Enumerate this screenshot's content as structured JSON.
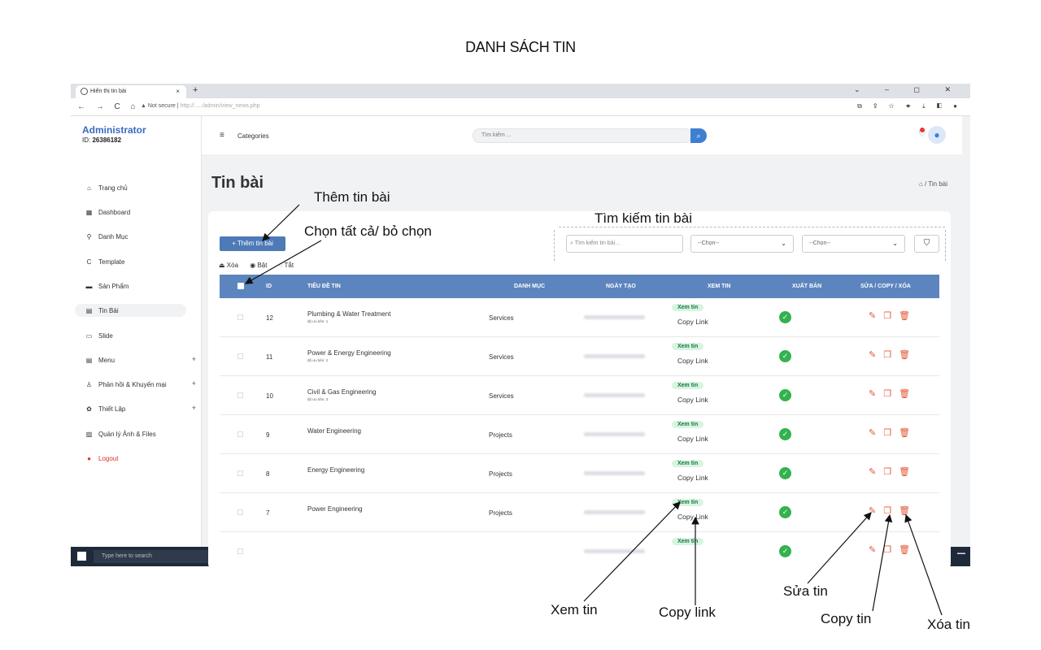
{
  "doc_title": "DANH SÁCH TIN",
  "browser": {
    "tab_title": "Hiển thị tin bài",
    "tab_close": "×",
    "new_tab": "+",
    "window_controls": "⌄ – ◻ ✕",
    "nav": "← → C ⌂",
    "security": "▲ Not secure",
    "url": "http://...../admin/view_news.php",
    "addr_icons": "⧉ ⇪ ☆ ✦ ⤓ ◧ ●"
  },
  "sidebar": {
    "admin_name": "Administrator",
    "admin_id_label": "ID:",
    "admin_id": "26386182",
    "items": [
      {
        "icon": "⌂",
        "label": "Trang chủ"
      },
      {
        "icon": "▦",
        "label": "Dashboard"
      },
      {
        "icon": "⚲",
        "label": "Danh Mục"
      },
      {
        "icon": "C",
        "label": "Template"
      },
      {
        "icon": "▬",
        "label": "Sản Phẩm"
      },
      {
        "icon": "▤",
        "label": "Tin Bài"
      },
      {
        "icon": "▭",
        "label": "Slide"
      },
      {
        "icon": "▤",
        "label": "Menu",
        "plus": "+"
      },
      {
        "icon": "♙",
        "label": "Phản hồi & Khuyến mại",
        "plus": "+"
      },
      {
        "icon": "✿",
        "label": "Thiết Lập",
        "plus": "+"
      },
      {
        "icon": "▨",
        "label": "Quản lý Ảnh & Files"
      },
      {
        "icon": "●",
        "label": "Logout"
      }
    ]
  },
  "topbar": {
    "menu_icon": "≡",
    "categories": "Categories",
    "search_placeholder": "Tìm kiếm ...",
    "search_icon": "⌕"
  },
  "content": {
    "page_title": "Tin bài",
    "breadcrumb": "⌂ / Tin bài",
    "add_button": "+ Thêm tin bài",
    "bulk_delete": "⏏ Xóa",
    "bulk_on": "◉ Bật",
    "bulk_off": "◌ Tắt",
    "filter_search_placeholder": "⌕ Tìm kiếm tin bài...",
    "select1": "--Chọn--",
    "select2": "--Chọn--",
    "filter_icon": "⛉"
  },
  "table": {
    "headers": {
      "id": "ID",
      "title": "TIÊU ĐỀ TIN",
      "category": "DANH MỤC",
      "date": "NGÀY TẠO",
      "view": "XEM TIN",
      "publish": "XUẤT BẢN",
      "actions": "SỬA / COPY / XÓA"
    },
    "view_label": "Xem tin",
    "copy_label": "Copy Link",
    "rows": [
      {
        "id": "12",
        "title": "Plumbing & Water Treatment",
        "sub": "độ ưu tiên: 1",
        "category": "Services"
      },
      {
        "id": "11",
        "title": "Power & Energy Engineering",
        "sub": "độ ưu tiên: 2",
        "category": "Services"
      },
      {
        "id": "10",
        "title": "Civil & Gas Engineering",
        "sub": "độ ưu tiên: 3",
        "category": "Services"
      },
      {
        "id": "9",
        "title": "Water Engineering",
        "sub": "",
        "category": "Projects"
      },
      {
        "id": "8",
        "title": "Energy Engineering",
        "sub": "",
        "category": "Projects"
      },
      {
        "id": "7",
        "title": "Power Engineering",
        "sub": "",
        "category": "Projects"
      },
      {
        "id": "",
        "title": "",
        "sub": "",
        "category": ""
      }
    ]
  },
  "taskbar": {
    "search": "Type here to search"
  },
  "annotations": {
    "add": "Thêm tin bài",
    "select_all": "Chọn tất cả/ bỏ chọn",
    "search": "Tìm kiếm tin bài",
    "view": "Xem tin",
    "copy_link": "Copy link",
    "edit": "Sửa tin",
    "copy": "Copy tin",
    "delete": "Xóa tin"
  },
  "colors": {
    "brand": "#3a6bbf",
    "table_header": "#5c85bf",
    "publish_ok": "#33b24d",
    "action": "#e25533"
  }
}
